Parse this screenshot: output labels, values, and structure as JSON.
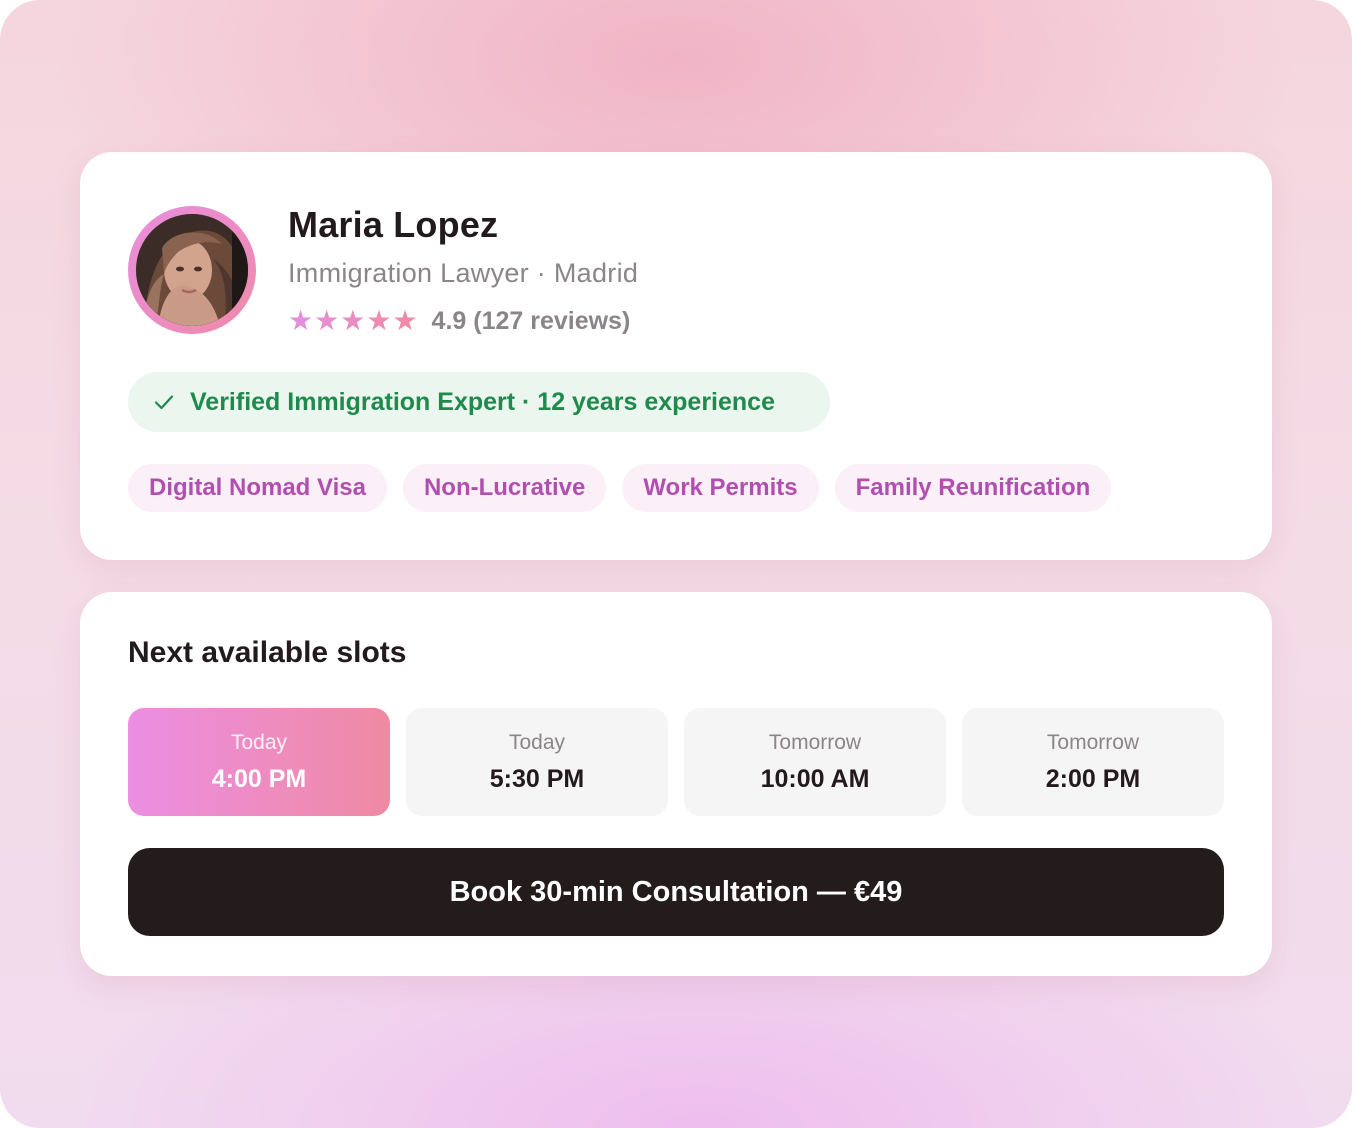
{
  "profile": {
    "name": "Maria Lopez",
    "subtitle": "Immigration Lawyer · Madrid",
    "stars": [
      "★",
      "★",
      "★",
      "★",
      "★"
    ],
    "rating_text": "4.9 (127 reviews)",
    "verified_text": "Verified Immigration Expert · 12 years experience",
    "tags": [
      "Digital Nomad Visa",
      "Non-Lucrative",
      "Work Permits",
      "Family Reunification"
    ]
  },
  "slots": {
    "title": "Next available slots",
    "items": [
      {
        "day": "Today",
        "time": "4:00 PM",
        "selected": true
      },
      {
        "day": "Today",
        "time": "5:30 PM",
        "selected": false
      },
      {
        "day": "Tomorrow",
        "time": "10:00 AM",
        "selected": false
      },
      {
        "day": "Tomorrow",
        "time": "2:00 PM",
        "selected": false
      }
    ]
  },
  "book_button_label": "Book 30-min Consultation — €49",
  "colors": {
    "accent_pink": "#ec8ee2",
    "accent_rose": "#ef8aa2",
    "star_start": "#e58fdc",
    "star_end": "#ef8aa8",
    "verified_green": "#1f8a4c",
    "tag_text": "#b14fb0",
    "button_dark": "#241b1d"
  },
  "icons": {
    "avatar": "avatar",
    "verified": "check-icon",
    "star": "star-icon"
  }
}
